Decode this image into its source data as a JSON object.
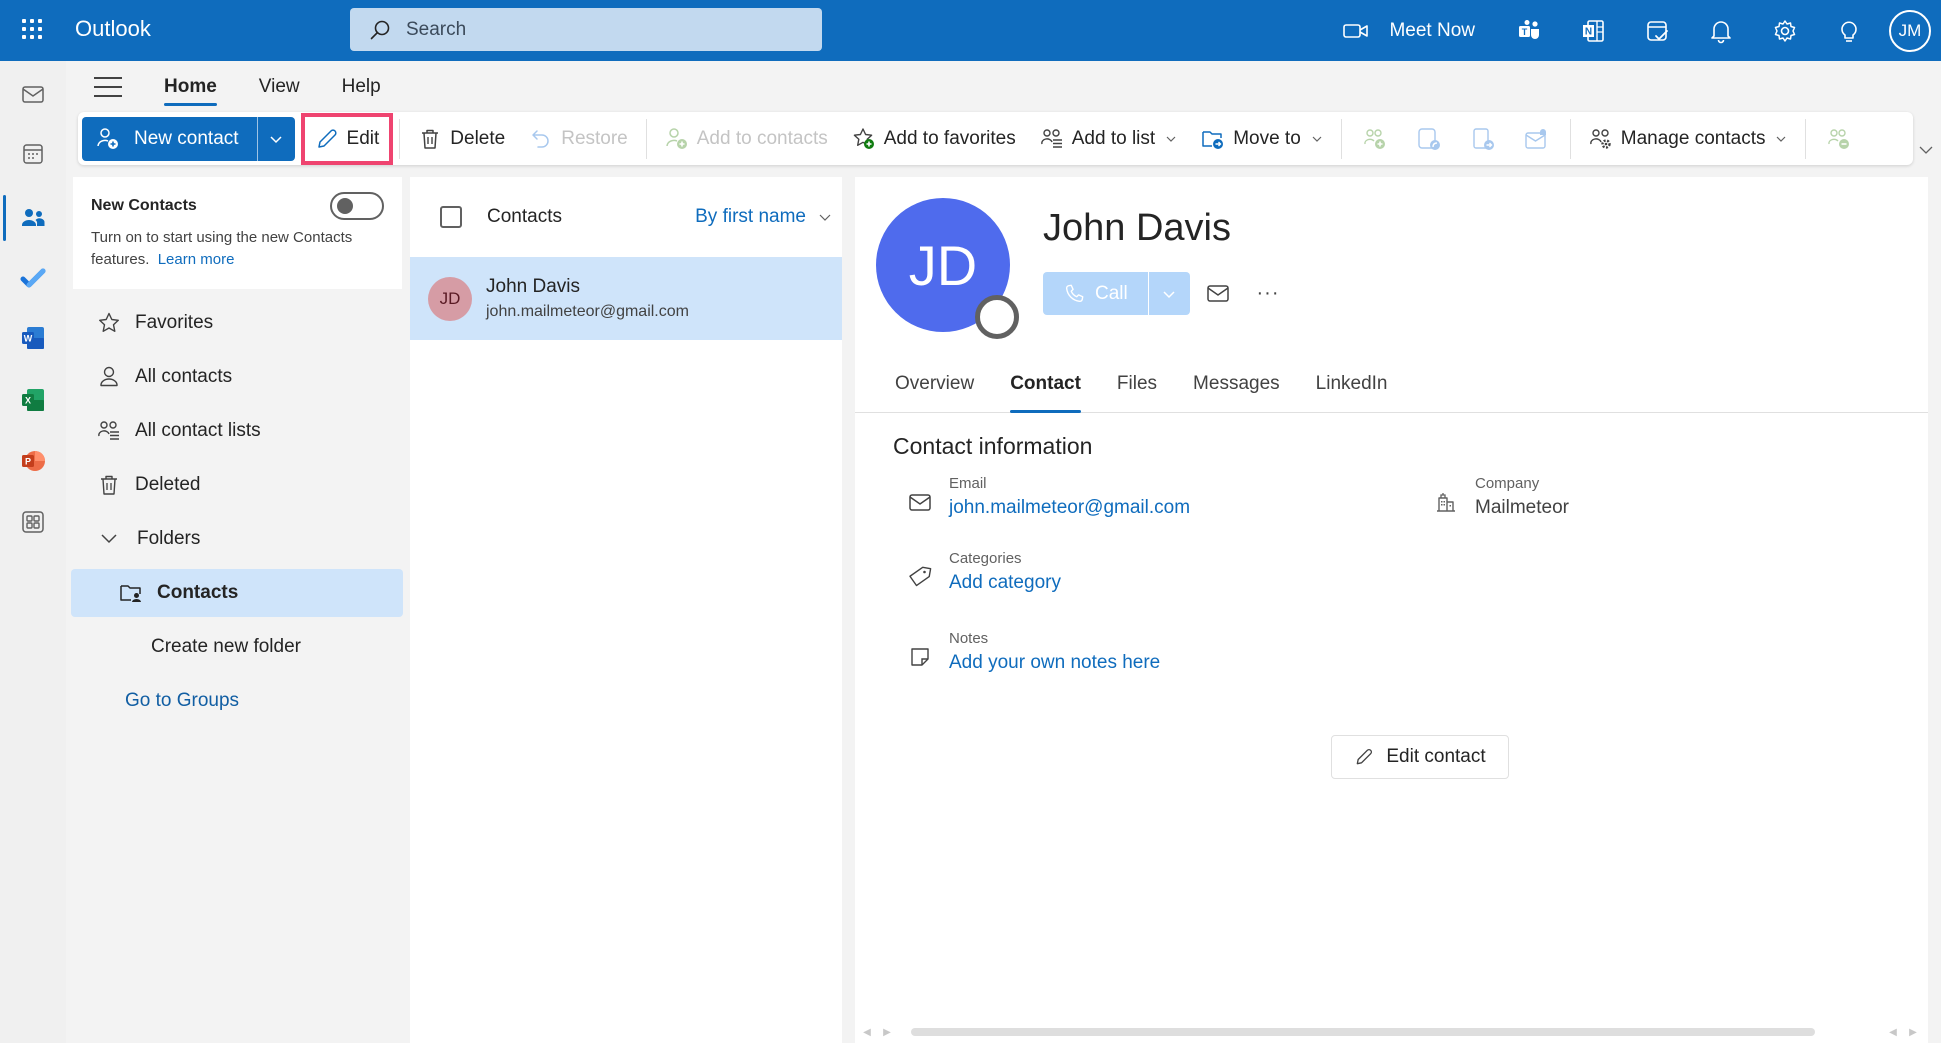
{
  "app": {
    "title": "Outlook",
    "search_placeholder": "Search",
    "meet_now": "Meet Now",
    "user_initials": "JM",
    "brand_color": "#0f6cbd"
  },
  "top_icons": [
    "teams-icon",
    "onenote-icon",
    "my-day-icon",
    "bell-icon",
    "gear-icon",
    "lightbulb-icon"
  ],
  "rail": {
    "items": [
      "mail",
      "calendar",
      "people",
      "todo",
      "word",
      "excel",
      "powerpoint",
      "more-apps"
    ],
    "active": "people"
  },
  "ribbon": {
    "tabs": [
      {
        "label": "Home",
        "active": true
      },
      {
        "label": "View",
        "active": false
      },
      {
        "label": "Help",
        "active": false
      }
    ],
    "new_contact": "New contact",
    "edit": "Edit",
    "delete": "Delete",
    "restore": "Restore",
    "add_to_contacts": "Add to contacts",
    "add_to_favorites": "Add to favorites",
    "add_to_list": "Add to list",
    "move_to": "Move to",
    "manage_contacts": "Manage contacts",
    "highlight_color": "#ef4470"
  },
  "new_contacts_card": {
    "title": "New Contacts",
    "description": "Turn on to start using the new Contacts features.",
    "link": "Learn more",
    "toggle_on": false
  },
  "nav": {
    "favorites": "Favorites",
    "all_contacts": "All contacts",
    "all_contact_lists": "All contact lists",
    "deleted": "Deleted",
    "folders": "Folders",
    "contacts_folder": "Contacts",
    "create_new_folder": "Create new folder",
    "go_to_groups": "Go to Groups"
  },
  "contact_list": {
    "title": "Contacts",
    "sort": "By first name",
    "rows": [
      {
        "initials": "JD",
        "name": "John Davis",
        "email": "john.mailmeteor@gmail.com",
        "selected": true
      }
    ]
  },
  "detail": {
    "initials": "JD",
    "name": "John Davis",
    "call": "Call",
    "tabs": [
      {
        "label": "Overview",
        "active": false
      },
      {
        "label": "Contact",
        "active": true
      },
      {
        "label": "Files",
        "active": false
      },
      {
        "label": "Messages",
        "active": false
      },
      {
        "label": "LinkedIn",
        "active": false
      }
    ],
    "section_title": "Contact information",
    "email_label": "Email",
    "email_value": "john.mailmeteor@gmail.com",
    "company_label": "Company",
    "company_value": "Mailmeteor",
    "categories_label": "Categories",
    "categories_value": "Add category",
    "notes_label": "Notes",
    "notes_value": "Add your own notes here",
    "edit_contact": "Edit contact"
  }
}
